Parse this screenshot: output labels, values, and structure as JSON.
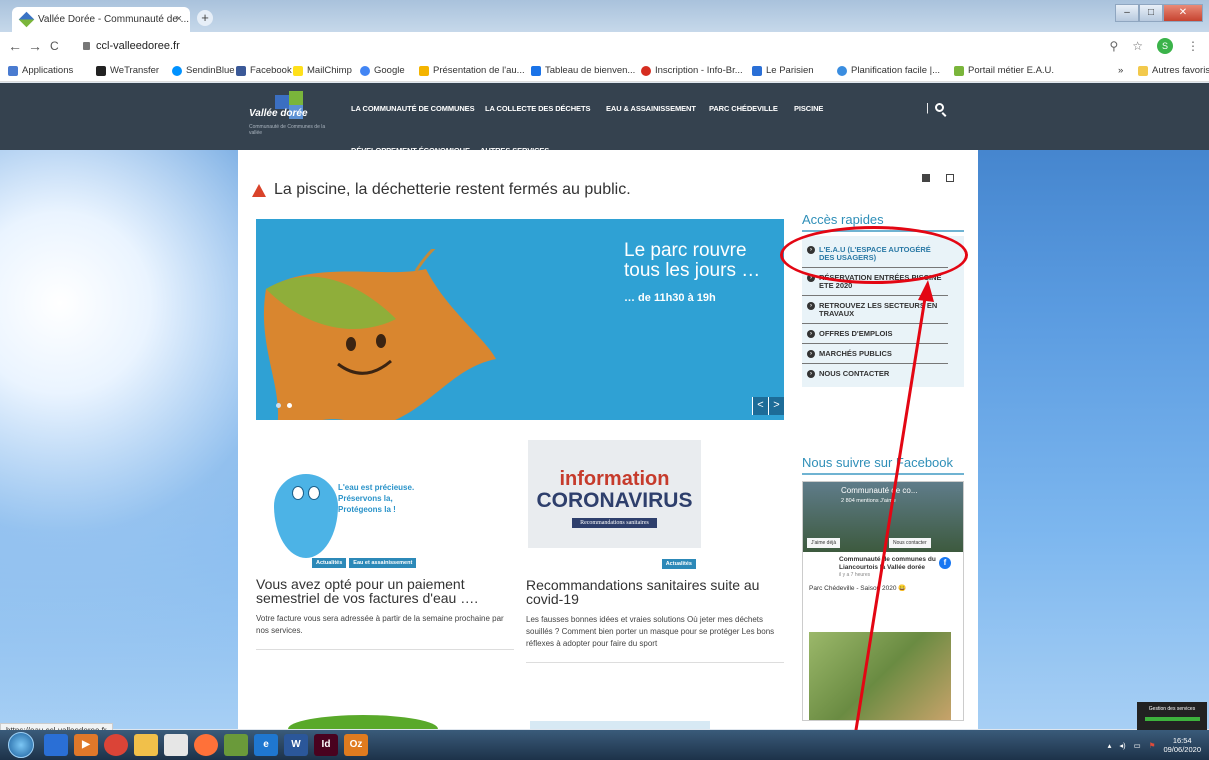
{
  "browser": {
    "tab_title": "Vallée Dorée - Communauté de ...",
    "tab_close": "×",
    "new_tab": "+",
    "window_minimize": "–",
    "window_maximize": "□",
    "window_close": "✕",
    "url": "ccl-valleedoree.fr",
    "back": "←",
    "forward": "→",
    "reload": "C",
    "zoom_icon": "⚲",
    "star": "☆",
    "profile_initial": "S",
    "menu": "⋮",
    "bookmarks": [
      {
        "label": "Applications",
        "color": "#4a7bd0"
      },
      {
        "label": "WeTransfer",
        "color": "#222222"
      },
      {
        "label": "SendinBlue",
        "color": "#0092ff"
      },
      {
        "label": "Facebook",
        "color": "#3b5998"
      },
      {
        "label": "MailChimp",
        "color": "#ffe01b"
      },
      {
        "label": "Google",
        "color": "#4285f4"
      },
      {
        "label": "Présentation de l'au...",
        "color": "#f4b400"
      },
      {
        "label": "Tableau de bienven...",
        "color": "#1a73e8"
      },
      {
        "label": "Inscription - Info-Br...",
        "color": "#d62d20"
      },
      {
        "label": "Le Parisien",
        "color": "#2a6fd6"
      },
      {
        "label": "Planification facile |...",
        "color": "#3a8de0"
      },
      {
        "label": "Portail métier E.A.U.",
        "color": "#7ab53b"
      }
    ],
    "bookmarks_more": "»",
    "other_bookmarks": "Autres favoris",
    "status_url": "https://eau.ccl-valleedoree.fr"
  },
  "site": {
    "logo_text": "Vallée dorée",
    "logo_sub": "Communauté de Communes de la vallée",
    "nav": [
      "LA COMMUNAUTÉ DE COMMUNES",
      "LA COLLECTE DES DÉCHETS",
      "EAU & ASSAINISSEMENT",
      "PARC CHÉDEVILLE",
      "PISCINE",
      "DÉVELOPPEMENT ÉCONOMIQUE",
      "AUTRES SERVICES"
    ],
    "search_sep": "|",
    "alert": "La piscine, la déchetterie restent fermés au public.",
    "social": [
      "facebook-icon",
      "youtube-icon"
    ],
    "slider": {
      "title": "Le parc rouvre tous les jours …",
      "subtitle": "… de 11h30 à 19h",
      "prev": "<",
      "next": ">"
    },
    "quick_access": {
      "title": "Accès rapides",
      "items": [
        "L'E.A.U (L'ESPACE AUTOGÉRÉ DES USAGERS)",
        "RÉSERVATION ENTRÉES PISCINE ETE 2020",
        "RETROUVEZ LES SECTEURS EN TRAVAUX",
        "OFFRES D'EMPLOIS",
        "MARCHÉS PUBLICS",
        "NOUS CONTACTER"
      ]
    },
    "articles": [
      {
        "image_text": "L'eau est précieuse. Préservons la, Protégeons la !",
        "tags": [
          "Actualités",
          "Eau et assainissement"
        ],
        "title": "Vous avez opté pour un paiement semestriel de vos factures d'eau ….",
        "excerpt": "Votre facture vous sera adressée à partir de la semaine prochaine par nos services."
      },
      {
        "image_line1": "information",
        "image_line2": "CORONAVIRUS",
        "image_line3": "Recommandations sanitaires",
        "tags": [
          "Actualités"
        ],
        "title": "Recommandations sanitaires suite au covid-19",
        "excerpt": "Les fausses bonnes idées et vraies solutions Où jeter mes déchets souillés ? Comment bien porter un masque pour se protéger Les bons réflexes à adopter pour faire du sport"
      }
    ],
    "facebook": {
      "title": "Nous suivre sur Facebook",
      "page_name": "Communauté de co...",
      "fans": "2 804 mentions J'aime",
      "like_btn": "J'aime déjà",
      "contact_btn": "Nous contacter",
      "post_author": "Communauté de communes du Liancourtois la Vallée dorée",
      "post_time": "il y a 7 heures",
      "post_text": "Parc Chédeville - Saison 2020 😀"
    }
  },
  "os": {
    "gadget_title": "Gestion des services",
    "time": "16:54",
    "date": "09/06/2020",
    "taskbar_apps": [
      {
        "name": "ie-app",
        "label": "",
        "color": "#2a6fd6"
      },
      {
        "name": "media-player",
        "label": "▶",
        "color": "#e0782a"
      },
      {
        "name": "chrome",
        "label": "",
        "color": "#db4437"
      },
      {
        "name": "explorer",
        "label": "",
        "color": "#f1c04a"
      },
      {
        "name": "paint",
        "label": "",
        "color": "#e6e6e6"
      },
      {
        "name": "firefox",
        "label": "",
        "color": "#ff7139"
      },
      {
        "name": "app-green",
        "label": "",
        "color": "#6a9a3a"
      },
      {
        "name": "internet-explorer",
        "label": "e",
        "color": "#1f77d0"
      },
      {
        "name": "word",
        "label": "W",
        "color": "#2b579a"
      },
      {
        "name": "indesign",
        "label": "Id",
        "color": "#49021f"
      },
      {
        "name": "outlook",
        "label": "Oz",
        "color": "#e07b1f"
      }
    ]
  }
}
